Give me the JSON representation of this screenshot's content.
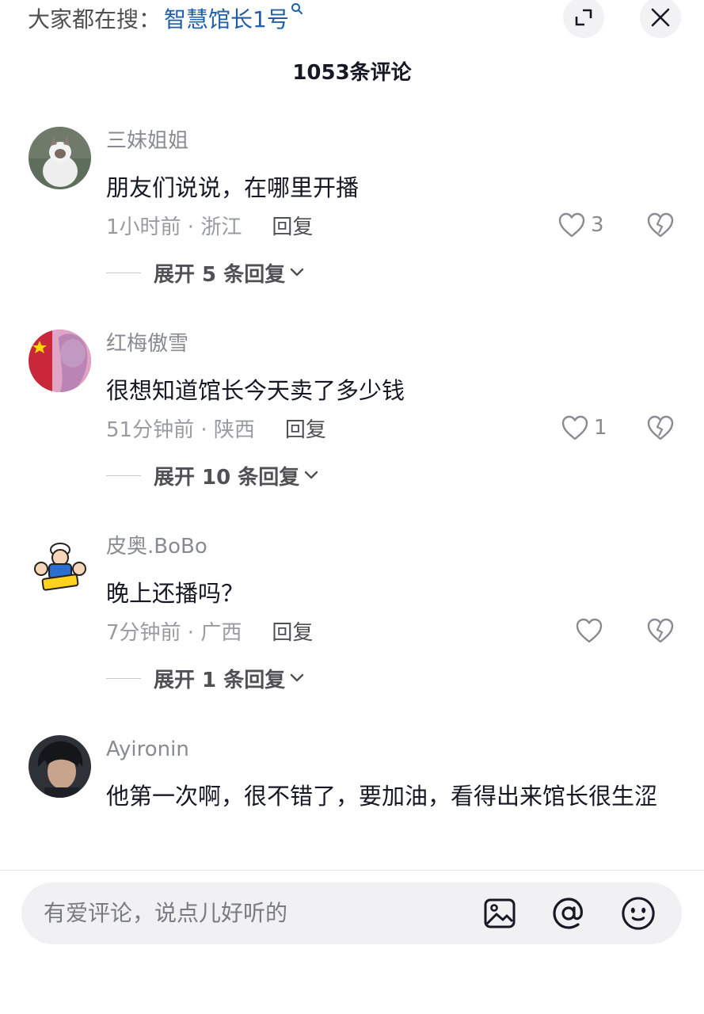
{
  "header": {
    "search_prefix": "大家都在搜：",
    "search_term": "智慧馆长1号",
    "comment_count": "1053条评论"
  },
  "comments": [
    {
      "nickname": "三妹姐姐",
      "content": "朋友们说说，在哪里开播",
      "meta": "1小时前 · 浙江",
      "reply_label": "回复",
      "likes": "3",
      "expand_label": "展开 5 条回复"
    },
    {
      "nickname": "红梅傲雪",
      "content": "很想知道馆长今天卖了多少钱",
      "meta": "51分钟前 · 陕西",
      "reply_label": "回复",
      "likes": "1",
      "expand_label": "展开 10 条回复"
    },
    {
      "nickname": "皮奥.BoBo",
      "content": "晚上还播吗？",
      "meta": "7分钟前 · 广西",
      "reply_label": "回复",
      "likes": "",
      "expand_label": "展开 1 条回复"
    },
    {
      "nickname": "Ayironin",
      "content": "他第一次啊，很不错了，要加油，看得出来馆长很生涩"
    }
  ],
  "input": {
    "placeholder": "有爱评论，说点儿好听的"
  },
  "colors": {
    "search_term": "#1f5fa8",
    "text_primary": "#161823",
    "text_secondary": "#8a8b91"
  },
  "icons": [
    "search-icon",
    "expand-icon",
    "close-icon",
    "heart-icon",
    "broken-heart-icon",
    "chevron-down-icon",
    "image-icon",
    "at-icon",
    "emoji-icon"
  ]
}
